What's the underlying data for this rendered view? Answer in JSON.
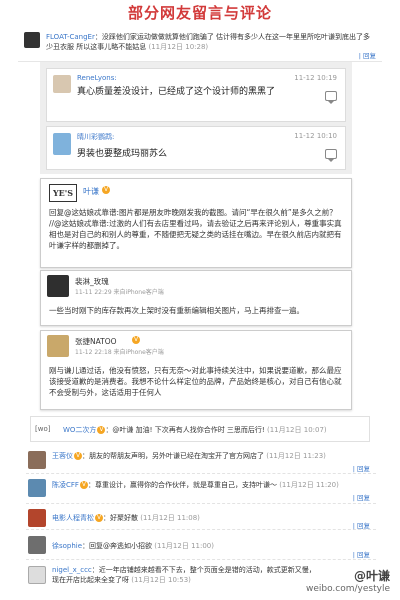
{
  "title": "部分网友留言与评论",
  "actions": {
    "reply": "回复",
    "sep": "|"
  },
  "comments": {
    "float": {
      "name": "FLOAT-CangEr",
      "text": "：没踩他们家运动做做就算他们跑骗了 估计得有多少人在这一年里里所吃叶谦到底出了多少丑衣服 所以这事儿略不能姑息",
      "time": "(11月12日 10:28)"
    },
    "rene": {
      "name": "ReneLyons:",
      "time": "11-12 10:19",
      "text": "真心质量差没设计，已经成了这个设计师的黑黑了"
    },
    "qingchuan": {
      "name": "晴川彩鹦鹉:",
      "time": "11-12 10:10",
      "text": "男装也要整成玛丽苏么"
    },
    "yeqian1": {
      "logo": "YE'S",
      "name": "叶谦",
      "text": "回复@这姑娘忒靠谱:图片都是朋友昨晚刚发我的截图。请问“早在很久前”是多久之前？ //@这姑娘忒靠谱:过激的人们有去店里看过吗，请去验证之后再来评论别人，尊重事实真相也是对自己的和别人的尊重，不随便把无疑之类的话挂在嘴边。早在很久前店内就把有叶谦字样的都删掉了。"
    },
    "peilin": {
      "name": "裴淋_玫瑰",
      "time": "11-11 22:29 来自iPhone客户端",
      "text": "一些当时刚下的库存款再次上架时没有重新编辑相关图片，马上再排查一遍。"
    },
    "zhangxi": {
      "name": "张捷NATOO",
      "time": "11-12 22:18 来自iPhone客户端",
      "text": "刚与谦儿通过话，他没有愤怒，只有无奈～对此事持续关注中，如果说要道歉，那么最应该接受道歉的是消费者。我想不论什么样定位的品牌，产品始终是核心，对自己有信心就不会受制与外，这话适用于任何人"
    },
    "wo": {
      "tag": "[wo]",
      "name": "WO二次方",
      "text": "：@叶谦 加油! 下次再有人找你合作时 三思而后行!",
      "time": "(11月12日 10:07)"
    },
    "list": [
      {
        "name": "王蓉仪",
        "text": "：朋友的帮朋友声明，另外叶谦已经在淘宝开了官方网店了",
        "time": "(11月12日 11:23)"
      },
      {
        "name": "陈凌CFF",
        "text": "：尊重设计，赢得你的合作伙伴，就是尊重自己，支持叶谦～",
        "time": "(11月12日 11:20)"
      },
      {
        "name": "电影人程青松",
        "text": "：好聚好散",
        "time": "(11月12日 11:08)"
      },
      {
        "name": "徐sophie",
        "text": "：回复@奔逃如小招欲",
        "time": "(11月12日 11:00)"
      },
      {
        "name": "nigel_x_ccc",
        "text": "：近一年店铺越来越看不下去，整个页面全是错的活动，款式更新又慢，现在开店比起来全变了呀",
        "time": "(11月12日 10:53)"
      }
    ]
  },
  "watermark": {
    "name": "@叶谦",
    "url": "weibo.com/yestyle"
  },
  "colors": {
    "title": "#d23a3a",
    "link": "#3b77c9",
    "badge": "#f5a623"
  }
}
